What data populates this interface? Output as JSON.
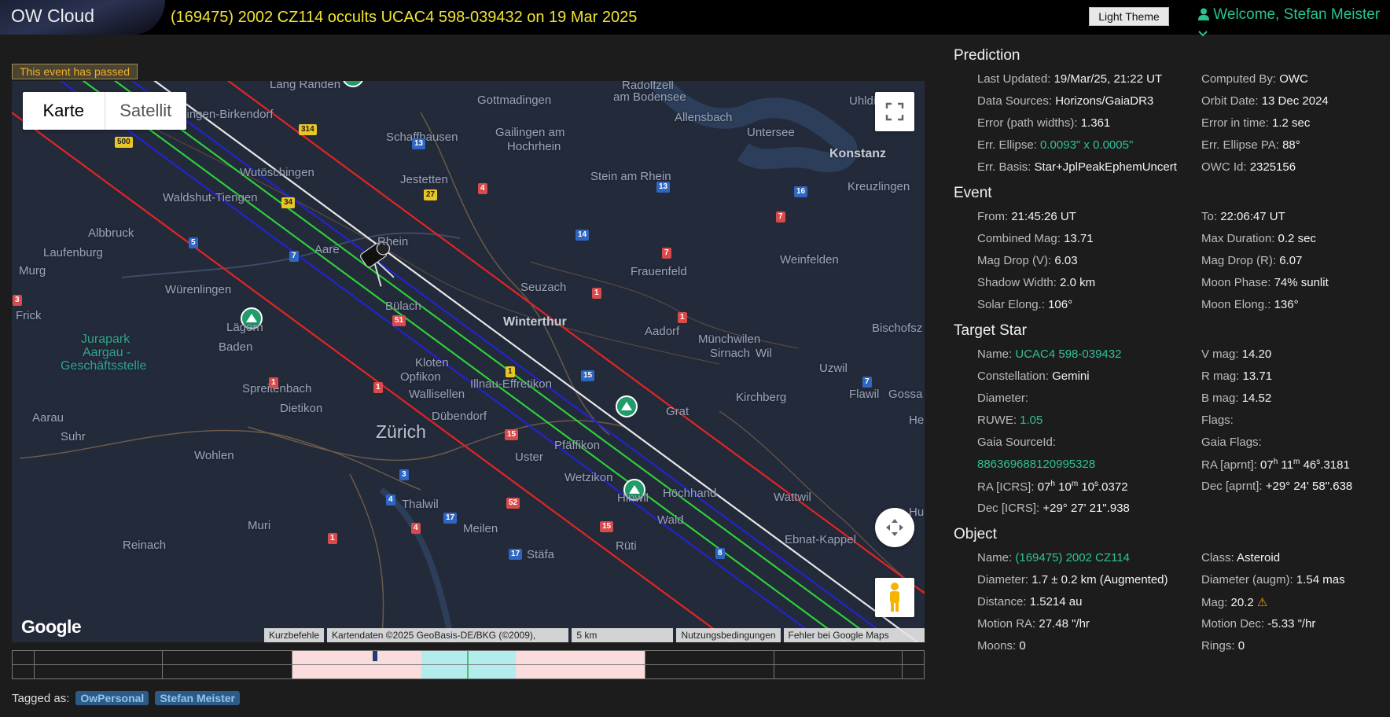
{
  "app": {
    "logo": "OW Cloud",
    "event_title": "(169475) 2002 CZ114 occults UCAC4 598-039432 on 19 Mar 2025",
    "theme_button": "Light Theme",
    "welcome": "Welcome, Stefan Meister",
    "user_icon": "user-icon",
    "dropdown_icon": "chevron-down-icon"
  },
  "banner": "This event has passed",
  "map": {
    "type_buttons": [
      "Karte",
      "Satellit"
    ],
    "google": "Google",
    "attribution": [
      "Kurzbefehle",
      "Kartendaten ©2025 GeoBasis-DE/BKG (©2009), Google",
      "5 km",
      "Nutzungsbedingungen",
      "Fehler bei Google Maps melden"
    ],
    "places": [
      "Lang Randen",
      "Radolfzell",
      "am Bodensee",
      "Ühlingen-Birkendorf",
      "Gottmadingen",
      "Allensbach",
      "Schaffhausen",
      "Gailingen am",
      "Hochrhein",
      "Uhldi",
      "Konstanz",
      "Wutöschingen",
      "Jestetten",
      "Stein am Rhein",
      "Kreuzlingen",
      "Waldshut-Tiengen",
      "Albbruck",
      "Laufenburg",
      "Frauenfeld",
      "Weinfelden",
      "Murg",
      "Seuzach",
      "Würenlingen",
      "Frick",
      "Bülach",
      "Winterthur",
      "Aadorf",
      "Bischofsz",
      "Lägern",
      "Baden",
      "Jurapark",
      "Aargau -",
      "Geschäftsstelle",
      "Münchwilen",
      "Sirnach",
      "Wil",
      "Kloten",
      "Opfikon",
      "Illnau-Effretikon",
      "Uzwil",
      "Spreitenbach",
      "Wallisellen",
      "Kirchberg",
      "Flawil",
      "Gossa",
      "Dietikon",
      "Grat",
      "Aarau",
      "Dübendorf",
      "Zürich",
      "Pfäffikon",
      "Suhr",
      "Wohlen",
      "Uster",
      "Wetzikon",
      "Hinwil",
      "Höchhand",
      "Wattwil",
      "Thalwil",
      "Muri",
      "Meilen",
      "Wald",
      "Reinach",
      "Rüti",
      "Ebnat-Kappel",
      "Untersee",
      "Rhein",
      "Aare",
      "Hu",
      "He",
      "Stäfa"
    ],
    "road_numbers": [
      "314",
      "500",
      "34",
      "13",
      "4",
      "27",
      "13",
      "16",
      "7",
      "5",
      "7",
      "14",
      "7",
      "1",
      "1",
      "3",
      "51",
      "1",
      "15",
      "7",
      "1",
      "1",
      "15",
      "3",
      "4",
      "52",
      "17",
      "15",
      "4",
      "1",
      "8",
      "17"
    ],
    "colors": {
      "path_white": "#e8e8e8",
      "path_green": "#2ecf3a",
      "path_blue": "#2323cf",
      "path_red": "#e42424"
    }
  },
  "timeline": {
    "colors": {
      "umbra": "#b3ecec",
      "penumbra": "#fadcdc",
      "center": "#47c36a"
    }
  },
  "tags": {
    "label": "Tagged as:",
    "items": [
      "OwPersonal",
      "Stefan Meister"
    ]
  },
  "panel": {
    "prediction": {
      "title": "Prediction",
      "rows": [
        {
          "l": "Last Updated:",
          "v": "19/Mar/25, 21:22 UT",
          "l2": "Computed By:",
          "v2": "OWC"
        },
        {
          "l": "Data Sources:",
          "v": "Horizons/GaiaDR3",
          "l2": "Orbit Date:",
          "v2": "13 Dec 2024"
        },
        {
          "l": "Error (path widths):",
          "v": "1.361",
          "l2": "Error in time:",
          "v2": "1.2 sec"
        },
        {
          "l": "Err. Ellipse:",
          "v": "0.0093\" x 0.0005\"",
          "l2": "Err. Ellipse PA:",
          "v2": "88°"
        },
        {
          "l": "Err. Basis:",
          "v": "Star+JplPeakEphemUncert",
          "l2": "OWC Id:",
          "v2": "2325156"
        }
      ]
    },
    "event": {
      "title": "Event",
      "rows": [
        {
          "l": "From:",
          "v": "21:45:26 UT",
          "l2": "To:",
          "v2": "22:06:47 UT"
        },
        {
          "l": "Combined Mag:",
          "v": "13.71",
          "l2": "Max Duration:",
          "v2": "0.2 sec"
        },
        {
          "l": "Mag Drop (V):",
          "v": "6.03",
          "l2": "Mag Drop (R):",
          "v2": "6.07"
        },
        {
          "l": "Shadow Width:",
          "v": "2.0 km",
          "l2": "Moon Phase:",
          "v2": "74% sunlit"
        },
        {
          "l": "Solar Elong.:",
          "v": "106°",
          "l2": "Moon Elong.:",
          "v2": "136°"
        }
      ]
    },
    "target": {
      "title": "Target Star",
      "rows": [
        {
          "l": "Name:",
          "v": "UCAC4 598-039432",
          "l2": "V mag:",
          "v2": "14.20"
        },
        {
          "l": "Constellation:",
          "v": "Gemini",
          "l2": "R mag:",
          "v2": "13.71"
        },
        {
          "l": "Diameter:",
          "v": "",
          "l2": "B mag:",
          "v2": "14.52"
        },
        {
          "l": "RUWE:",
          "v": "1.05",
          "l2": "Flags:",
          "v2": ""
        },
        {
          "l": "Gaia SourceId:",
          "v": "",
          "l2": "Gaia Flags:",
          "v2": ""
        }
      ],
      "gaia_id": "886369688120995328",
      "ra_apr_label": "RA [aprnt]:",
      "ra_apr": {
        "h": "07",
        "m": "11",
        "s": "46",
        "f": ".3181"
      },
      "ra_icrs_label": "RA [ICRS]:",
      "ra_icrs": {
        "h": "07",
        "m": "10",
        "s": "10",
        "f": ".0372"
      },
      "dec_apr_label": "Dec [aprnt]:",
      "dec_apr": "+29° 24' 58\".638",
      "dec_icrs_label": "Dec [ICRS]:",
      "dec_icrs": "+29° 27' 21\".938"
    },
    "object": {
      "title": "Object",
      "rows": [
        {
          "l": "Name:",
          "v": "(169475) 2002 CZ114",
          "l2": "Class:",
          "v2": "Asteroid"
        },
        {
          "l": "Diameter:",
          "v": "1.7 ± 0.2 km  (Augmented)",
          "l2": "Diameter (augm):",
          "v2": "1.54 mas"
        },
        {
          "l": "Distance:",
          "v": "1.5214 au",
          "l2": "Mag:",
          "v2": "20.2"
        },
        {
          "l": "Motion RA:",
          "v": "27.48 \"/hr",
          "l2": "Motion Dec:",
          "v2": "-5.33 \"/hr"
        },
        {
          "l": "Moons:",
          "v": "0",
          "l2": "Rings:",
          "v2": "0"
        }
      ]
    }
  }
}
